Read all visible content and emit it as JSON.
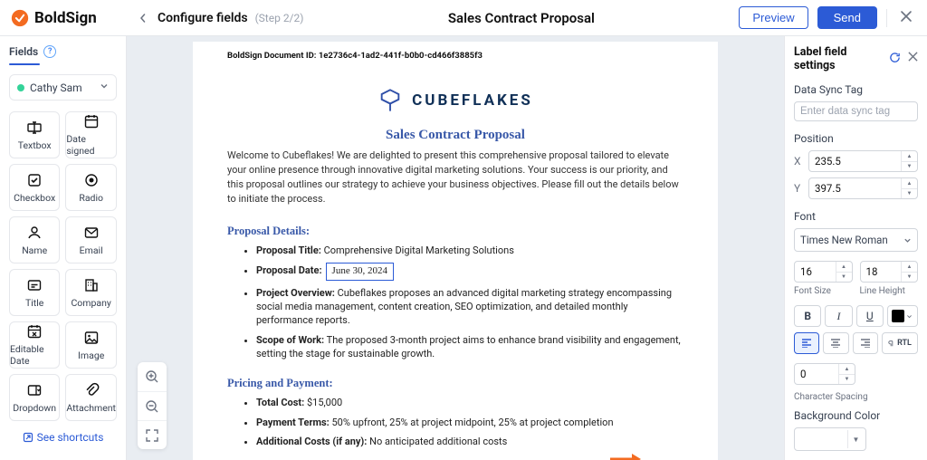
{
  "brand": {
    "name": "BoldSign"
  },
  "header": {
    "crumb_title": "Configure fields",
    "step": "(Step 2/2)",
    "page_title": "Sales Contract Proposal",
    "preview": "Preview",
    "send": "Send"
  },
  "left": {
    "fields_label": "Fields",
    "signer_name": "Cathy Sam",
    "palette": [
      {
        "name": "textbox",
        "label": "Textbox"
      },
      {
        "name": "date-signed",
        "label": "Date signed"
      },
      {
        "name": "checkbox",
        "label": "Checkbox"
      },
      {
        "name": "radio",
        "label": "Radio"
      },
      {
        "name": "name",
        "label": "Name"
      },
      {
        "name": "email",
        "label": "Email"
      },
      {
        "name": "title",
        "label": "Title"
      },
      {
        "name": "company",
        "label": "Company"
      },
      {
        "name": "editable-date",
        "label": "Editable Date"
      },
      {
        "name": "image",
        "label": "Image"
      },
      {
        "name": "dropdown",
        "label": "Dropdown"
      },
      {
        "name": "attachment",
        "label": "Attachment"
      }
    ],
    "shortcuts": "See shortcuts"
  },
  "doc": {
    "doc_id_label": "BoldSign Document ID: 1e2736c4-1ad2-441f-b0b0-cd466f3885f3",
    "logo_text": "CUBEFLAKES",
    "title": "Sales Contract Proposal",
    "intro": "Welcome to Cubeflakes! We are delighted to present this comprehensive proposal tailored to elevate your online presence through innovative digital marketing solutions. Your success is our priority, and this proposal outlines our strategy to achieve your business objectives. Please fill out the details below to initiate the process.",
    "proposal_details_h": "Proposal Details:",
    "items": [
      {
        "k": "Proposal Title:",
        "v": " Comprehensive Digital Marketing Solutions"
      },
      {
        "k": "Proposal Date:",
        "v": "June 30, 2024"
      },
      {
        "k": "Project Overview:",
        "v": " Cubeflakes proposes an advanced digital marketing strategy encompassing social media management, content creation, SEO optimization, and detailed monthly performance reports."
      },
      {
        "k": "Scope of Work:",
        "v": " The proposed 3-month project aims to enhance brand visibility and engagement, setting the stage for sustainable growth."
      }
    ],
    "pricing_h": "Pricing and Payment:",
    "pricing": [
      {
        "k": "Total Cost:",
        "v": " $15,000"
      },
      {
        "k": "Payment Terms:",
        "v": " 50% upfront, 25% at project midpoint, 25% at project completion"
      },
      {
        "k": "Additional Costs (if any):",
        "v": " No anticipated additional costs"
      }
    ]
  },
  "right": {
    "title": "Label field settings",
    "data_sync_label": "Data Sync Tag",
    "data_sync_placeholder": "Enter data sync tag",
    "position_label": "Position",
    "x_label": "X",
    "y_label": "Y",
    "x_value": "235.5",
    "y_value": "397.5",
    "font_label": "Font",
    "font_value": "Times New Roman",
    "font_size_value": "16",
    "line_height_value": "18",
    "font_size_label": "Font Size",
    "line_height_label": "Line Height",
    "rtl_label": "RTL",
    "char_spacing_value": "0",
    "char_spacing_label": "Character Spacing",
    "bg_color_label": "Background Color"
  }
}
